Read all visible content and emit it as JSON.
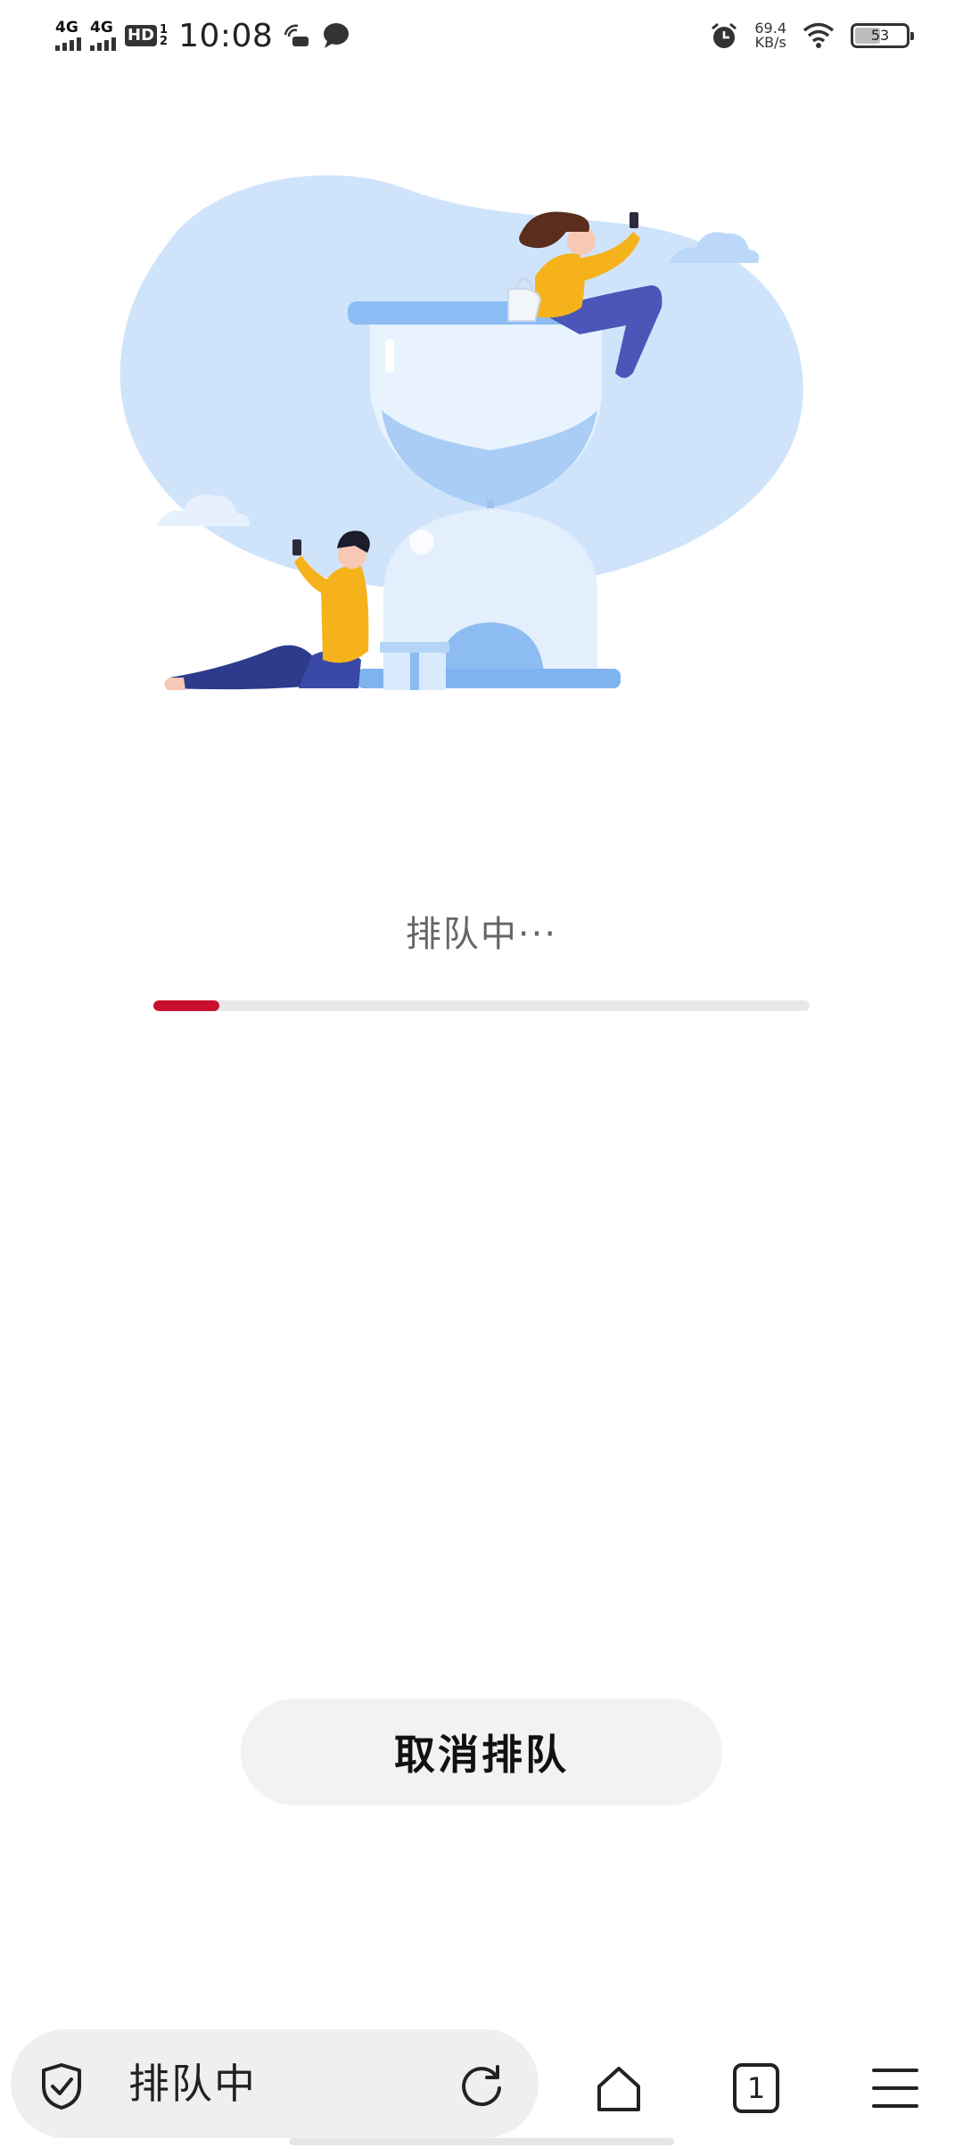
{
  "status_bar": {
    "signal1": "4G",
    "signal2": "4G",
    "hd": "HD",
    "hd_sub_top": "1",
    "hd_sub_bottom": "2",
    "time": "10:08",
    "speed_value": "69.4",
    "speed_unit": "KB/s",
    "battery": "53",
    "battery_level": 0.53
  },
  "queue": {
    "status_text": "排队中···",
    "progress": 0.1
  },
  "cancel_button": {
    "label": "取消排队"
  },
  "bottom_bar": {
    "address_text": "排队中",
    "tab_count": "1"
  },
  "colors": {
    "accent": "#c8102e",
    "track": "#e8e8e8",
    "illustration_blue": "#cfe4fb"
  }
}
